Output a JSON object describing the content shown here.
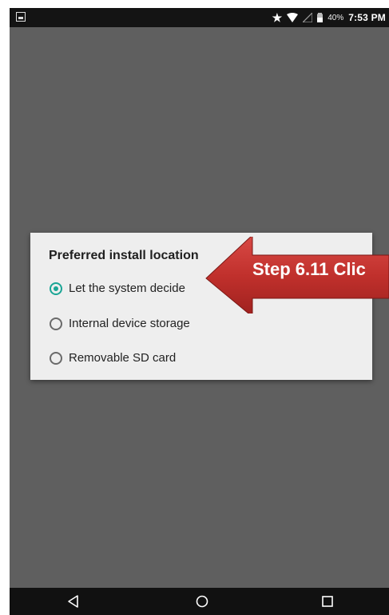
{
  "statusbar": {
    "battery": "40%",
    "time": "7:53 PM"
  },
  "dialog": {
    "title": "Preferred install location",
    "options": [
      {
        "label": "Let the system decide",
        "selected": true
      },
      {
        "label": "Internal device storage",
        "selected": false
      },
      {
        "label": "Removable SD card",
        "selected": false
      }
    ]
  },
  "annotation": {
    "text": "Step 6.11 Clic"
  },
  "colors": {
    "accent": "#1aa595",
    "callout": "#c62828",
    "screen_bg": "#5f5f5f",
    "dialog_bg": "#eeeeee"
  },
  "icons": {
    "nav_back": "back-icon",
    "nav_home": "home-icon",
    "nav_recents": "recents-icon"
  }
}
